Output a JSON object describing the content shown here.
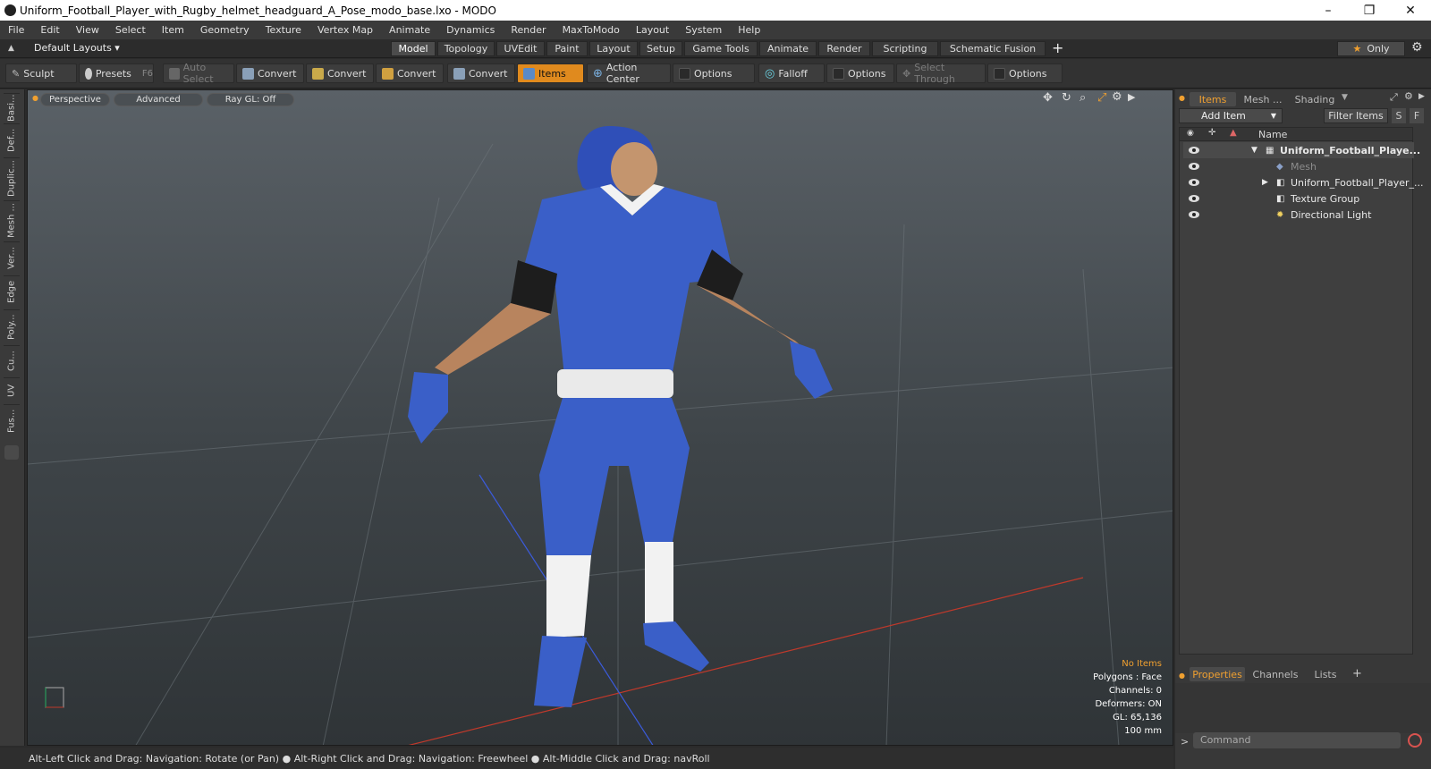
{
  "window": {
    "title": "Uniform_Football_Player_with_Rugby_helmet_headguard_A_Pose_modo_base.lxo - MODO",
    "minimize": "–",
    "maximize": "❐",
    "close": "✕"
  },
  "menu": [
    "File",
    "Edit",
    "View",
    "Select",
    "Item",
    "Geometry",
    "Texture",
    "Vertex Map",
    "Animate",
    "Dynamics",
    "Render",
    "MaxToModo",
    "Layout",
    "System",
    "Help"
  ],
  "layouts": {
    "default": "Default Layouts ▾",
    "tabs": [
      "Model",
      "Topology",
      "UVEdit",
      "Paint",
      "Layout",
      "Setup",
      "Game Tools",
      "Animate",
      "Render",
      "Scripting",
      "Schematic Fusion"
    ],
    "active": "Model",
    "add": "+",
    "only": "Only"
  },
  "toolbar": {
    "sculpt": "Sculpt",
    "presets": "Presets",
    "presets_key": "F6",
    "auto_select": "Auto Select",
    "convert": "Convert",
    "items": "Items",
    "action_center": "Action Center",
    "options": "Options",
    "falloff": "Falloff",
    "select_through": "Select Through"
  },
  "left_tabs": [
    "Basi...",
    "Def...",
    "Duplic...",
    "Mesh ...",
    "Ver...",
    "Edge",
    "Poly...",
    "Cu...",
    "UV",
    "Fus..."
  ],
  "viewport": {
    "perspective": "Perspective",
    "advanced": "Advanced",
    "raygl": "Ray GL: Off"
  },
  "hud": {
    "no_items": "No Items",
    "polygons": "Polygons : Face",
    "channels": "Channels: 0",
    "deformers": "Deformers: ON",
    "gl": "GL: 65,136",
    "units": "100 mm"
  },
  "status": "Alt-Left Click and Drag: Navigation: Rotate (or Pan) ● Alt-Right Click and Drag: Navigation: Freewheel ● Alt-Middle Click and Drag: navRoll",
  "panel": {
    "tabs": [
      "Items",
      "Mesh ...",
      "Shading"
    ],
    "active": "Items",
    "add_item": "Add Item",
    "filter": "Filter Items",
    "s": "S",
    "f": "F",
    "col_name": "Name",
    "tree": [
      {
        "label": "Uniform_Football_Playe...",
        "bold": true
      },
      {
        "label": "Mesh",
        "dim": true
      },
      {
        "label": "Uniform_Football_Player_..."
      },
      {
        "label": "Texture Group"
      },
      {
        "label": "Directional Light"
      }
    ],
    "bottom_tabs": [
      "Properties",
      "Channels",
      "Lists"
    ],
    "bottom_active": "Properties",
    "command": "Command"
  },
  "colors": {
    "accent": "#e08a1e",
    "jersey": "#3a5fc8"
  }
}
